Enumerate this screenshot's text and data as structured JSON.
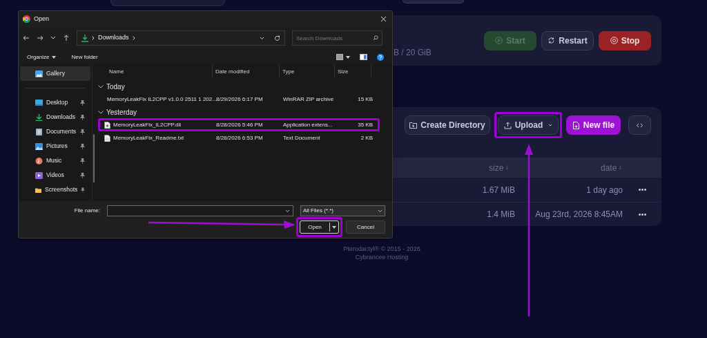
{
  "dialog": {
    "title": "Open",
    "address": {
      "path": [
        "Downloads"
      ]
    },
    "search": {
      "placeholder": "Search Downloads"
    },
    "toolbar": [
      "Organize",
      "New folder"
    ],
    "sidebar": {
      "items": [
        {
          "label": "Gallery",
          "kind": "gallery",
          "selected": true,
          "pinned": false
        },
        {
          "label": "Desktop",
          "kind": "desktop",
          "selected": false,
          "pinned": true
        },
        {
          "label": "Downloads",
          "kind": "downloads",
          "selected": false,
          "pinned": true
        },
        {
          "label": "Documents",
          "kind": "documents",
          "selected": false,
          "pinned": true
        },
        {
          "label": "Pictures",
          "kind": "pictures",
          "selected": false,
          "pinned": true
        },
        {
          "label": "Music",
          "kind": "music",
          "selected": false,
          "pinned": true
        },
        {
          "label": "Videos",
          "kind": "videos",
          "selected": false,
          "pinned": true
        },
        {
          "label": "Screenshots",
          "kind": "folder",
          "selected": false,
          "pinned": true
        }
      ]
    },
    "columns": [
      "Name",
      "Date modified",
      "Type",
      "Size"
    ],
    "groups": [
      {
        "label": "Today",
        "expanded": true,
        "files": [
          {
            "name": "MemoryLeakFix IL2CPP v1.0.0 2511 1 202...",
            "date": "8/29/2026 6:17 PM",
            "type": "WinRAR ZIP archive",
            "size": "15 KB",
            "kind": "archive",
            "highlighted": false
          }
        ]
      },
      {
        "label": "Yesterday",
        "expanded": true,
        "files": [
          {
            "name": "MemoryLeakFix_IL2CPP.dll",
            "date": "8/28/2026 5:46 PM",
            "type": "Application extens...",
            "size": "35 KB",
            "kind": "library",
            "highlighted": true
          },
          {
            "name": "MemoryLeakFix_Readme.txt",
            "date": "8/28/2026 6:53 PM",
            "type": "Text Document",
            "size": "2 KB",
            "kind": "text",
            "highlighted": false
          }
        ]
      }
    ],
    "file_name": {
      "label": "File name:"
    },
    "file_type": "All Files (*.*)",
    "buttons": [
      {
        "label": "Open",
        "kind": "split",
        "highlighted": true
      },
      {
        "label": "Cancel",
        "kind": "plain",
        "highlighted": false
      }
    ]
  },
  "panel": {
    "usage_fragment": "B / 20 GiB",
    "power_buttons": [
      {
        "label": "Start",
        "kind": "start",
        "disabled": true
      },
      {
        "label": "Restart",
        "kind": "restart",
        "disabled": false
      },
      {
        "label": "Stop",
        "kind": "stop",
        "disabled": false
      }
    ],
    "file_actions": [
      {
        "label": "Create Directory",
        "kind": "directory",
        "highlighted": false
      },
      {
        "label": "Upload",
        "kind": "upload",
        "highlighted": true
      },
      {
        "label": "New file",
        "kind": "new",
        "highlighted": false
      },
      {
        "kind": "code",
        "highlighted": false
      }
    ],
    "table": {
      "columns": [
        "size",
        "date"
      ],
      "rows": [
        {
          "size": "1.67 MiB",
          "date": "1 day ago"
        },
        {
          "size": "1.4 MiB",
          "date": "Aug 23rd, 2026 8:45AM"
        }
      ]
    }
  },
  "footer": [
    "Pterodactyl® © 2015 - 2026",
    "Cybrancee Hosting"
  ]
}
